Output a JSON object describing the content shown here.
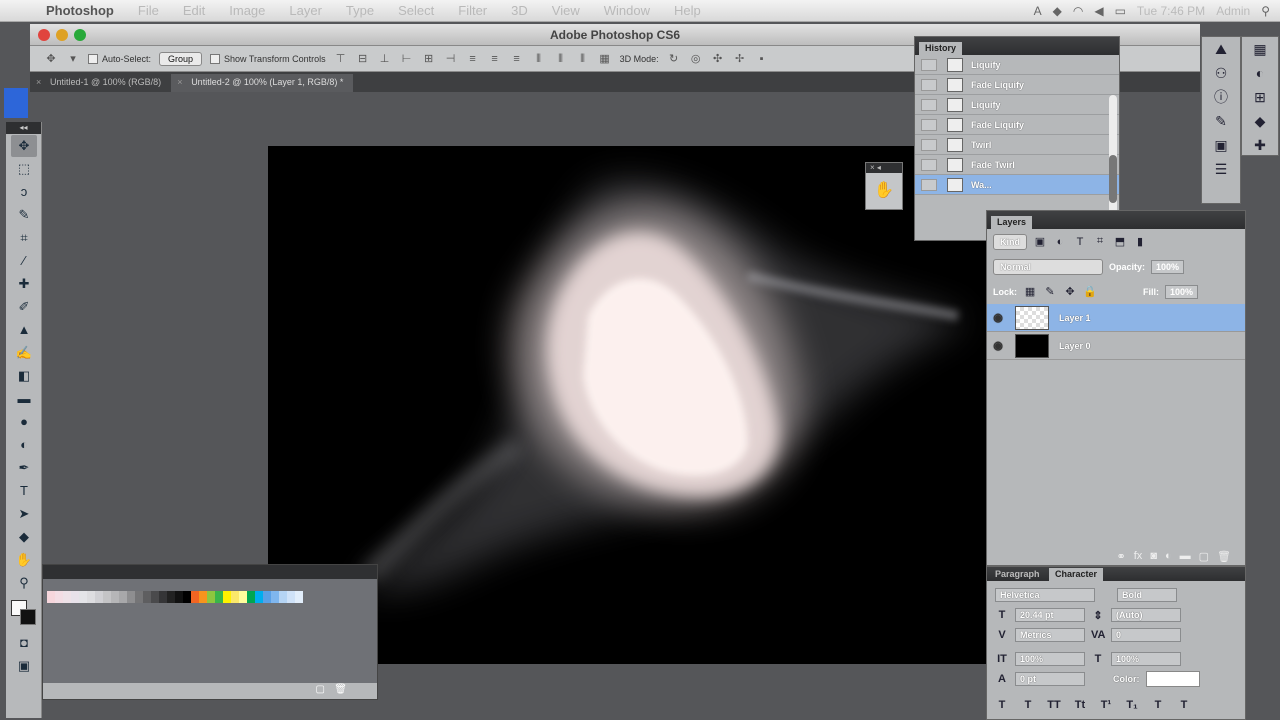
{
  "menubar": {
    "items": [
      "Photoshop",
      "File",
      "Edit",
      "Image",
      "Layer",
      "Type",
      "Select",
      "Filter",
      "3D",
      "View",
      "Window",
      "Help"
    ],
    "clock": "Tue 7:46 PM",
    "user": "Admin"
  },
  "app": {
    "title": "Adobe Photoshop CS6"
  },
  "options": {
    "auto_select": "Auto-Select:",
    "auto_select_value": "Group",
    "show_transform": "Show Transform Controls",
    "mode_3d": "3D Mode:"
  },
  "tabs": [
    {
      "label": "Untitled-1 @ 100% (RGB/8)"
    },
    {
      "label": "Untitled-2 @ 100% (Layer 1, RGB/8) *"
    }
  ],
  "history": {
    "title": "History",
    "items": [
      "Liquify",
      "Fade Liquify",
      "Liquify",
      "Fade Liquify",
      "Twirl",
      "Fade Twirl",
      "Wa..."
    ]
  },
  "layers": {
    "title": "Layers",
    "filter": "Kind",
    "blend": "Normal",
    "opacity_label": "Opacity:",
    "opacity": "100%",
    "lock_label": "Lock:",
    "fill_label": "Fill:",
    "fill": "100%",
    "items": [
      {
        "name": "Layer 1",
        "selected": true
      },
      {
        "name": "Layer 0",
        "selected": false
      }
    ]
  },
  "character": {
    "tab_paragraph": "Paragraph",
    "tab_character": "Character",
    "font": "Helvetica",
    "style": "Bold",
    "size": "20.44 pt",
    "leading": "(Auto)",
    "kerning": "Metrics",
    "tracking": "0",
    "vscale": "100%",
    "hscale": "100%",
    "baseline": "0 pt",
    "color_label": "Color:"
  },
  "swatches": {
    "colors": [
      "#f6d6dc",
      "#f3dde4",
      "#eee2e8",
      "#e8e2ea",
      "#e4e4e8",
      "#dddde0",
      "#d0d0d4",
      "#c4c4c6",
      "#b6b6b8",
      "#a8a8aa",
      "#8e8e90",
      "#757577",
      "#5e5e60",
      "#4a4a4c",
      "#353537",
      "#222",
      "#111",
      "#000",
      "#f26522",
      "#f7941d",
      "#8dc63f",
      "#39b54a",
      "#fff200",
      "#fbe86a",
      "#fffd9c",
      "#00a651",
      "#00aeef",
      "#5aa0e6",
      "#7fb6ee",
      "#b5d4f4",
      "#cfe2f8",
      "#e2eefb"
    ]
  },
  "colors": {
    "selection_blue": "#8db4e6",
    "panel_gray": "#b6b8ba",
    "workspace": "#555659"
  }
}
